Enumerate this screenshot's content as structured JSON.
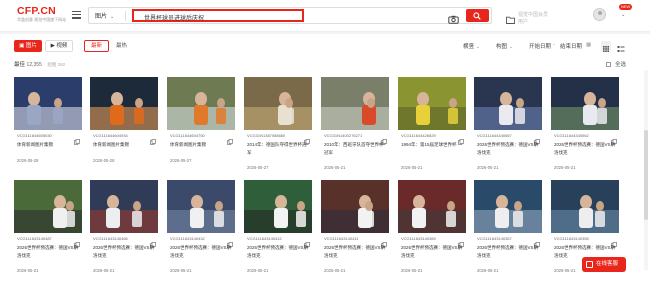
{
  "header": {
    "logo_main": "CFP.CN",
    "logo_sub": "华盖创意 视觉中国旗下网站",
    "category_label": "图片",
    "search_value": "世界杯球员进球后庆祝",
    "user_name": "视觉中国会员用户",
    "new_badge": "NEW"
  },
  "filters": {
    "image_tab": "图片",
    "video_tab": "视频",
    "sort_new": "最新",
    "sort_hot": "最热",
    "orientation": "横竖",
    "color": "构图",
    "start_date": "开始日期",
    "end_date": "结束日期"
  },
  "results": {
    "label": "最佳",
    "count": "12,355",
    "extra": "组图 262",
    "select_all": "全选"
  },
  "cards": [
    {
      "id": "VCG111644605030",
      "title": "体育新闻图片集锦",
      "date": "2026-05-28"
    },
    {
      "id": "VCG111644604934",
      "title": "体育新闻图片集锦",
      "date": "2026-05-28"
    },
    {
      "id": "VCG111644604750",
      "title": "体育新闻图片集锦",
      "date": "2026-05-27"
    },
    {
      "id": "VCG31N1387088660",
      "title": "2014年：德国队夺得世界杯冠军",
      "date": "2026-05-27"
    },
    {
      "id": "VCG31N1400276271",
      "title": "2010年：西班牙队首夺世界杯冠军",
      "date": "2026-05-21"
    },
    {
      "id": "VCG111644426829",
      "title": "1994年：第15届足球世界杯",
      "date": "2026-05-21"
    },
    {
      "id": "VCG111644340667",
      "title": "2026世界杯预选赛：德国VS斯洛伐克",
      "date": "2026-05-21"
    },
    {
      "id": "VCG111644340562",
      "title": "2026世界杯预选赛：德国VS斯洛伐克",
      "date": "2026-05-21"
    },
    {
      "id": "VCG111643140487",
      "title": "2026世界杯预选赛：德国VS斯洛伐克",
      "date": "2026-05-21"
    },
    {
      "id": "VCG111643140466",
      "title": "2026世界杯预选赛：德国VS斯洛伐克",
      "date": "2026-05-21"
    },
    {
      "id": "VCG111643140432",
      "title": "2026世界杯预选赛：德国VS斯洛伐克",
      "date": "2026-05-21"
    },
    {
      "id": "VCG111643140412",
      "title": "2026世界杯预选赛：德国VS斯洛伐克",
      "date": "2026-05-21"
    },
    {
      "id": "VCG111643140411",
      "title": "2026世界杯预选赛：德国VS斯洛伐克",
      "date": "2026-05-21"
    },
    {
      "id": "VCG111643140369",
      "title": "2026世界杯预选赛：德国VS斯洛伐克",
      "date": "2026-05-21"
    },
    {
      "id": "VCG111643140367",
      "title": "2026世界杯预选赛：德国VS斯洛伐克",
      "date": "2026-05-21"
    },
    {
      "id": "VCG111643140355",
      "title": "2026世界杯预选赛：德国VS斯洛伐克",
      "date": "2026-05-21"
    }
  ],
  "feedback_label": "在线客服",
  "colors": {
    "brand": "#e8261b"
  }
}
